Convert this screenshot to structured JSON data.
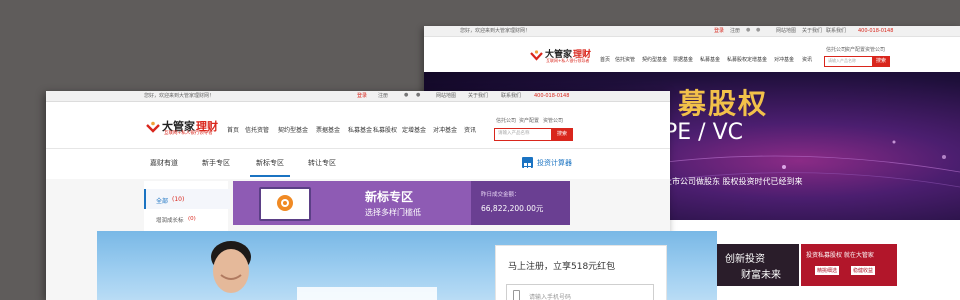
{
  "back_window": {
    "topbar": {
      "welcome": "您好，欢迎来到大管家理财网！",
      "login": "登录",
      "register": "注册",
      "links": [
        "网站地图",
        "关于我们",
        "联系我们"
      ],
      "phone": "400-018-0148"
    },
    "logo": {
      "brand": "大管家",
      "sub": "理财",
      "tagline": "互联网+私人银行领导者"
    },
    "nav": [
      "首页",
      "信托资管",
      "契约型基金",
      "票据基金",
      "私募基金",
      "私募股权",
      "定增基金",
      "对冲基金",
      "资讯"
    ],
    "quick_links": [
      "信托公司",
      "资产配置",
      "资管公司"
    ],
    "search": {
      "placeholder": "请输入产品名称",
      "button": "搜索"
    },
    "banner": {
      "title": "募股权",
      "subtitle": "PE / VC",
      "line": "上市公司做股东  股权投资时代已经到来"
    },
    "promo": {
      "left": "创新投资",
      "left2": "财富未来",
      "right": "投资私募股权 就在大管家",
      "btn1": "精挑细选",
      "btn2": "稳健收益"
    }
  },
  "front_window": {
    "topbar": {
      "welcome": "您好，欢迎来到大管家理财网！",
      "login": "登录",
      "register": "注册",
      "links": [
        "网站地图",
        "关于我们",
        "联系我们"
      ],
      "phone": "400-018-0148"
    },
    "logo": {
      "brand": "大管家",
      "sub": "理财",
      "tagline": "互联网+私人银行领导者"
    },
    "nav": [
      "首页",
      "信托资管",
      "契约型基金",
      "票据基金",
      "私募基金",
      "私募股权",
      "定增基金",
      "对冲基金",
      "资讯"
    ],
    "quick_links": [
      "信托公司",
      "资产配置",
      "资管公司"
    ],
    "search": {
      "placeholder": "请输入产品名称",
      "button": "搜索"
    },
    "tabs": [
      "嘉财有道",
      "新手专区",
      "新标专区",
      "转让专区"
    ],
    "active_tab": 2,
    "calculator": "投资计算器",
    "sidebar": {
      "all": "全部",
      "all_count": "(10)",
      "item": "增润成长标",
      "item_count": "(0)"
    },
    "promo_banner": {
      "title": "新标专区",
      "subtitle": "选择多样门槛低",
      "stat_label": "昨日成交金额：",
      "stat_value": "66,822,200.00元"
    }
  },
  "register_window": {
    "headline": "马上注册，立享518元红包",
    "phone_placeholder": "请输入手机号码"
  },
  "colors": {
    "brand_red": "#d9261c",
    "accent_blue": "#1a73c2",
    "promo_purple": "#8e5bb4"
  }
}
